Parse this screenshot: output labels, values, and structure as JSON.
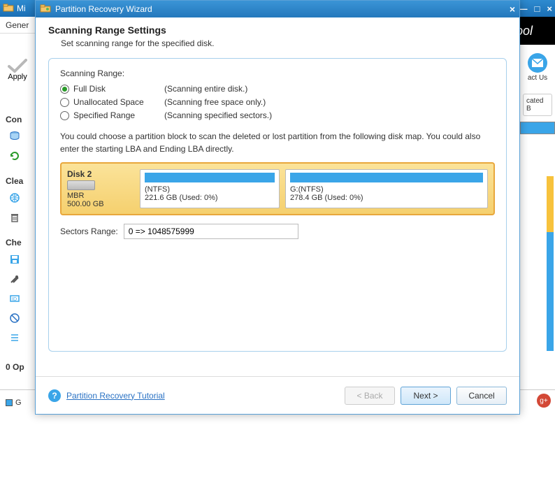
{
  "bg": {
    "title": "Mi",
    "menu": "Gener",
    "apply": "Apply",
    "sections": {
      "con": "Con",
      "clea": "Clea",
      "che": "Che"
    },
    "ops": "0 Op",
    "legend": "G",
    "contact": "act Us",
    "logo": "ool",
    "right_panel": {
      "l1": "cated",
      "l2": "B"
    }
  },
  "dialog": {
    "title": "Partition Recovery Wizard",
    "heading": "Scanning Range Settings",
    "subheading": "Set scanning range for the specified disk.",
    "panel_title": "Scanning Range:",
    "options": [
      {
        "label": "Full Disk",
        "desc": "(Scanning entire disk.)",
        "checked": true
      },
      {
        "label": "Unallocated Space",
        "desc": "(Scanning free space only.)",
        "checked": false
      },
      {
        "label": "Specified Range",
        "desc": "(Scanning specified sectors.)",
        "checked": false
      }
    ],
    "instructions": "You could choose a partition block to scan the deleted or lost partition from the following disk map. You could also enter the starting LBA and Ending LBA directly.",
    "disk": {
      "name": "Disk 2",
      "type": "MBR",
      "size": "500.00 GB",
      "partitions": [
        {
          "label": "(NTFS)",
          "info": "221.6 GB (Used: 0%)"
        },
        {
          "label": "G:(NTFS)",
          "info": "278.4 GB (Used: 0%)"
        }
      ]
    },
    "sectors_label": "Sectors Range:",
    "sectors_value": "0 => 1048575999",
    "help": "Partition Recovery Tutorial",
    "buttons": {
      "back": "< Back",
      "next": "Next >",
      "cancel": "Cancel"
    }
  }
}
